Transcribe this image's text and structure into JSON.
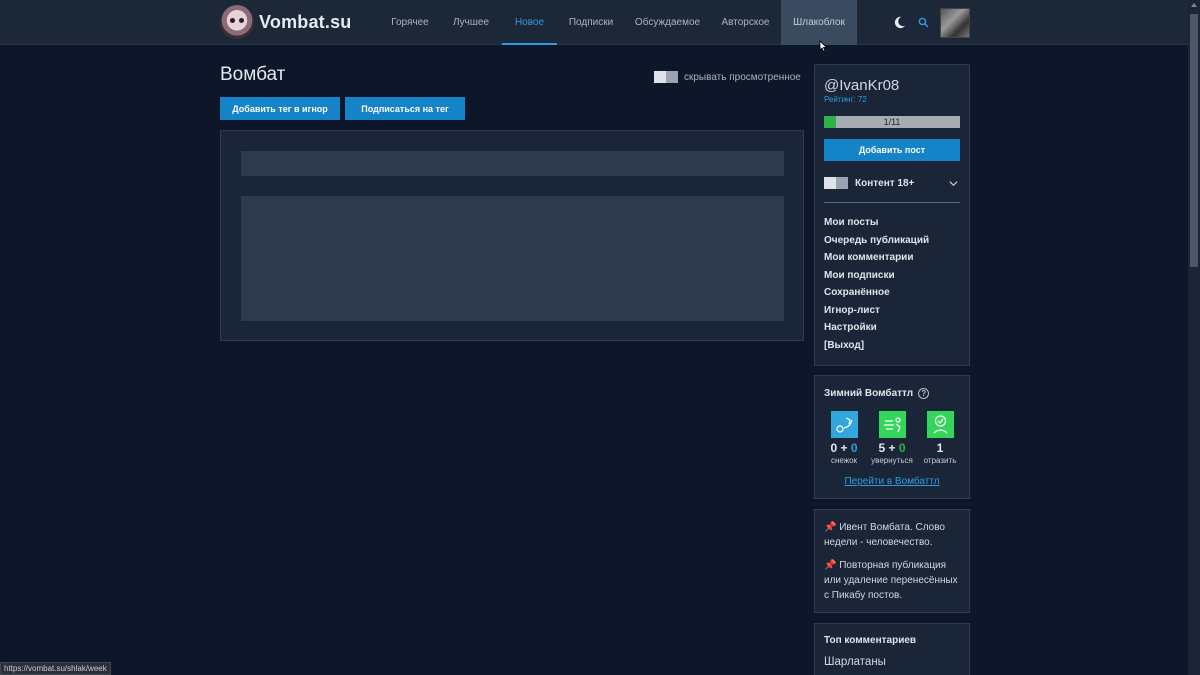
{
  "header": {
    "brand": "Vombat.su",
    "nav": [
      {
        "label": "Горячее",
        "state": "normal"
      },
      {
        "label": "Лучшее",
        "state": "normal"
      },
      {
        "label": "Новое",
        "state": "active"
      },
      {
        "label": "Подписки",
        "state": "normal"
      },
      {
        "label": "Обсуждаемое",
        "state": "normal"
      },
      {
        "label": "Авторское",
        "state": "normal"
      },
      {
        "label": "Шлакоблок",
        "state": "hover"
      }
    ],
    "icons": [
      "moon-icon",
      "search-icon"
    ],
    "accent_color": "#2e9ce0"
  },
  "main": {
    "title": "Вомбат",
    "hide_seen_label": "скрывать просмотренное",
    "buttons": {
      "ignore_tag": "Добавить тег в игнор",
      "subscribe_tag": "Подписаться на тег"
    },
    "button_color": "#1583c7"
  },
  "user": {
    "username": "@IvanKr08",
    "rating": "Рейтинг: 72",
    "progress_text": "1/11",
    "progress_fraction": 0.091,
    "add_post": "Добавить пост",
    "content18": "Контент 18+",
    "menu": [
      "Мои посты",
      "Очередь публикаций",
      "Мои комментарии",
      "Мои подписки",
      "Сохранённое",
      "Игнор-лист",
      "Настройки",
      "[Выход]"
    ]
  },
  "battle": {
    "title": "Зимний Вомбаттл",
    "items": [
      {
        "base": "0",
        "plus": "0",
        "label": "снежок",
        "icon": "snowball-icon",
        "color": "#33a7dd"
      },
      {
        "base": "5",
        "plus": "0",
        "label": "увернуться",
        "icon": "dodge-icon",
        "color": "#33d65a"
      },
      {
        "base": "1",
        "plus": "",
        "label": "отразить",
        "icon": "shield-icon",
        "color": "#33d65a"
      }
    ],
    "link": "Перейти в Вомбаттл"
  },
  "info": {
    "items": [
      "📌 Ивент Вомбата. Слово недели - человечество.",
      "📌 Повторная публикация или удаление перенесённых с Пикабу постов."
    ]
  },
  "top_comments": {
    "title": "Топ комментариев",
    "preview": "Шарлатаны"
  },
  "status_bar": {
    "url": "https://vombat.su/shlak/week"
  }
}
